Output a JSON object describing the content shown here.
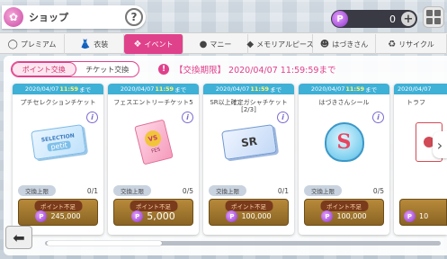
{
  "header": {
    "title": "ショップ",
    "help": "?"
  },
  "currency": {
    "symbol": "P",
    "value": "0",
    "plus": "+"
  },
  "tabs": [
    {
      "label": "プレミアム",
      "icon": "◯"
    },
    {
      "label": "衣装",
      "icon": "👗"
    },
    {
      "label": "イベント",
      "icon": "❖"
    },
    {
      "label": "マニー",
      "icon": "●"
    },
    {
      "label": "メモリアルピース",
      "icon": "◆"
    },
    {
      "label": "はづきさん",
      "icon": "☻"
    },
    {
      "label": "リサイクル",
      "icon": "♻"
    }
  ],
  "subtabs": {
    "point": "ポイント交換",
    "ticket": "チケット交換"
  },
  "notice": {
    "icon": "!",
    "text": "【交換期限】 2020/04/07 11:59:59まで"
  },
  "cards": [
    {
      "date": "2020/04/07",
      "time": "11:59",
      "suffix": "まで",
      "name": "プチセレクションチケット",
      "limit_label": "交換上限",
      "limit_value": "0/1",
      "shortage": "ポイント不足",
      "cost": "245,000",
      "art_t1": "SELECTION",
      "art_t2": "petit"
    },
    {
      "date": "2020/04/07",
      "time": "11:59",
      "suffix": "まで",
      "name": "フェスエントリーチケット5",
      "limit_label": "交換上限",
      "limit_value": "0/5",
      "shortage": "ポイント不足",
      "cost": "5,000",
      "art_t1": "VS",
      "art_t2": "FES"
    },
    {
      "date": "2020/04/07",
      "time": "11:59",
      "suffix": "まで",
      "name": "SR以上確定ガシャチケット\n[2/3]",
      "limit_label": "交換上限",
      "limit_value": "0/1",
      "shortage": "ポイント不足",
      "cost": "100,000",
      "art_t1": "SR"
    },
    {
      "date": "2020/04/07",
      "time": "11:59",
      "suffix": "まで",
      "name": "はづきさんシール",
      "limit_label": "交換上限",
      "limit_value": "0/5",
      "shortage": "ポイント不足",
      "cost": "100,000",
      "art_t1": "S"
    },
    {
      "date": "2020/04/07",
      "time": "11:59",
      "suffix": "まで",
      "name": "トラフ",
      "limit_label": "交換上限",
      "limit_value": "",
      "shortage": "",
      "cost": "10"
    }
  ],
  "cost_icon": "P",
  "nav": {
    "next": "›",
    "back": "⬅"
  },
  "colors": {
    "accent": "#e0418b",
    "date_bar": "#3fb0d6",
    "button_gold": "#b88a3a"
  }
}
